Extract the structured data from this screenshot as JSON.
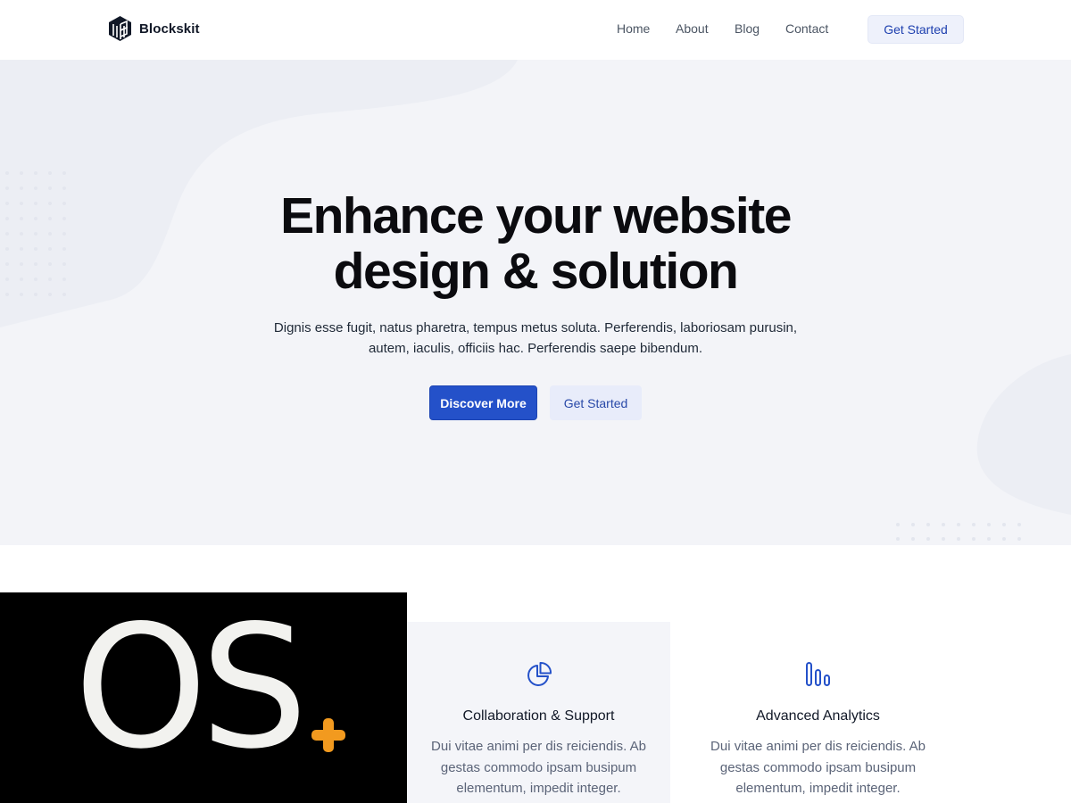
{
  "header": {
    "brand": "Blockskit",
    "nav": [
      "Home",
      "About",
      "Blog",
      "Contact"
    ],
    "cta": "Get Started"
  },
  "hero": {
    "title_line1": "Enhance your website",
    "title_line2": "design & solution",
    "subtitle": "Dignis esse fugit, natus pharetra, tempus metus soluta. Perferendis, laboriosam purusin, autem, iaculis, officiis hac. Perferendis saepe bibendum.",
    "primary_button": "Discover More",
    "secondary_button": "Get Started"
  },
  "promo": {
    "text": "OS",
    "plus_color": "#f29a1f"
  },
  "features": [
    {
      "title": "Collaboration & Support",
      "text": "Dui vitae animi per dis reiciendis. Ab gestas commodo ipsam busipum elementum, impedit integer.",
      "icon": "pie-chart-icon"
    },
    {
      "title": "Advanced Analytics",
      "text": "Dui vitae animi per dis reiciendis. Ab gestas commodo ipsam busipum elementum, impedit integer.",
      "icon": "bar-chart-icon"
    }
  ],
  "colors": {
    "accent": "#2451c9",
    "hero_bg": "#f3f4f8"
  }
}
